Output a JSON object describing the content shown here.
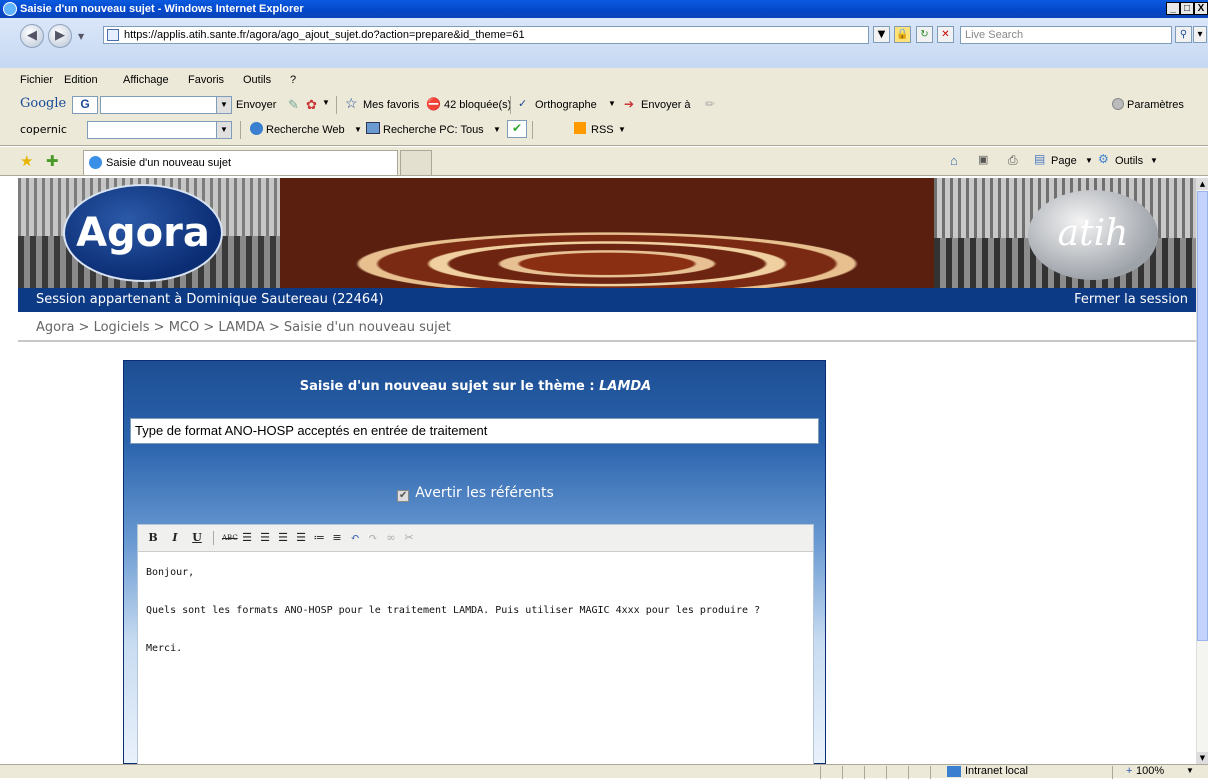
{
  "window": {
    "title": "Saisie d'un nouveau sujet - Windows Internet Explorer",
    "minimize": "_",
    "maximize": "□",
    "close": "X"
  },
  "address": {
    "url": "https://applis.atih.sante.fr/agora/ago_ajout_sujet.do?action=prepare&id_theme=61",
    "search_placeholder": "Live Search"
  },
  "menu": [
    "Fichier",
    "Edition",
    "Affichage",
    "Favoris",
    "Outils",
    "?"
  ],
  "google_toolbar": {
    "brand": "Google",
    "send": "Envoyer",
    "favorites": "Mes favoris",
    "blocked": "42 bloquée(s)",
    "spelling": "Orthographe",
    "send_to": "Envoyer à",
    "settings": "Paramètres"
  },
  "copernic_toolbar": {
    "brand": "copernic",
    "web_search": "Recherche Web",
    "pc_search": "Recherche PC: Tous",
    "rss": "RSS"
  },
  "tabs": {
    "active": "Saisie d'un nouveau sujet"
  },
  "command_bar": {
    "page": "Page",
    "tools": "Outils"
  },
  "banner": {
    "logo_left": "Agora",
    "logo_right": "atih"
  },
  "session": {
    "owner": "Session appartenant à Dominique Sautereau (22464)",
    "logout": "Fermer la session"
  },
  "breadcrumb": "Agora > Logiciels > MCO > LAMDA > Saisie d'un nouveau sujet",
  "form": {
    "title_prefix": "Saisie d'un nouveau sujet sur le thème : ",
    "theme": "LAMDA",
    "subject_value": "Type de format ANO-HOSP acceptés en entrée de traitement",
    "notify_label": "Avertir les référents",
    "notify_checked": true
  },
  "editor": {
    "toolbar": [
      "B",
      "I",
      "U"
    ],
    "lines": [
      "Bonjour,",
      "Quels sont les formats ANO-HOSP pour le traitement LAMDA. Puis utiliser MAGIC 4xxx pour les produire ?",
      "Merci."
    ]
  },
  "status": {
    "zone": "Intranet local",
    "zoom": "100%"
  },
  "colors": {
    "session_bar": "#0d3a84",
    "panel_top": "#1d4e93"
  }
}
